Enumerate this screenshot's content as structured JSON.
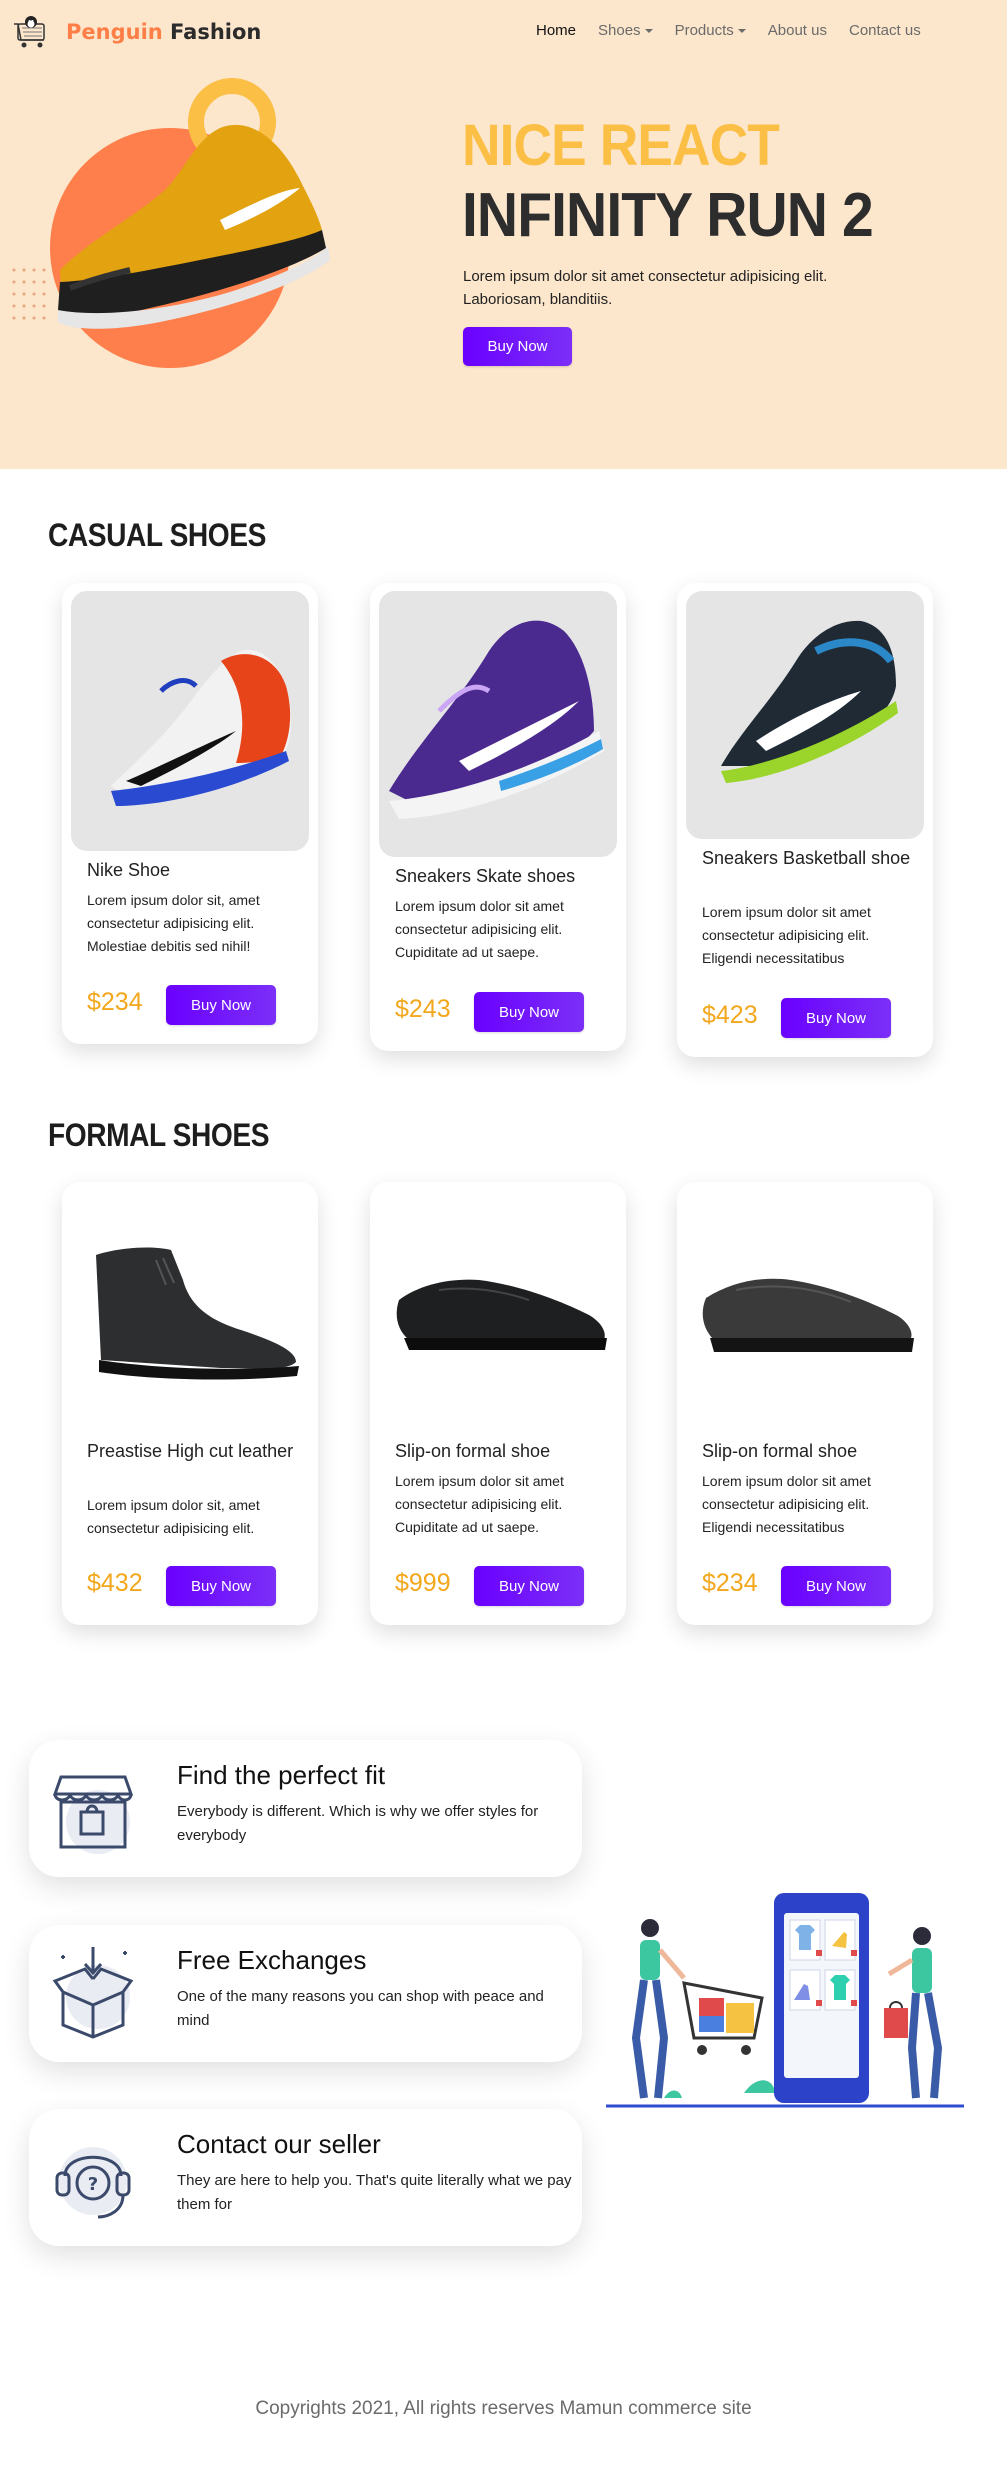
{
  "brand": {
    "accent": "Penguin",
    "rest": "Fashion"
  },
  "nav": {
    "links": [
      {
        "label": "Home",
        "dropdown": false,
        "active": true
      },
      {
        "label": "Shoes",
        "dropdown": true,
        "active": false
      },
      {
        "label": "Products",
        "dropdown": true,
        "active": false
      },
      {
        "label": "About us",
        "dropdown": false,
        "active": false
      },
      {
        "label": "Contact us",
        "dropdown": false,
        "active": false
      }
    ]
  },
  "hero": {
    "title_line1": "NICE REACT",
    "title_line2": "INFINITY RUN 2",
    "text": "Lorem ipsum dolor sit amet consectetur adipisicing elit. Laboriosam, blanditiis.",
    "button": "Buy Now"
  },
  "casual": {
    "title": "CASUAL SHOES",
    "cards": [
      {
        "name": "Nike Shoe",
        "desc": "Lorem ipsum dolor sit, amet consectetur adipisicing elit. Molestiae debitis sed nihil!",
        "price": "$234",
        "button": "Buy Now"
      },
      {
        "name": "Sneakers Skate shoes",
        "desc": "Lorem ipsum dolor sit amet consectetur adipisicing elit. Cupiditate ad ut saepe.",
        "price": "$243",
        "button": "Buy Now"
      },
      {
        "name": "Sneakers Basketball shoe",
        "desc": "Lorem ipsum dolor sit amet consectetur adipisicing elit. Eligendi necessitatibus",
        "price": "$423",
        "button": "Buy Now"
      }
    ]
  },
  "formal": {
    "title": "FORMAL SHOES",
    "cards": [
      {
        "name": "Preastise High cut leather",
        "desc": "Lorem ipsum dolor sit, amet consectetur adipisicing elit.",
        "price": "$432",
        "button": "Buy Now"
      },
      {
        "name": "Slip-on formal shoe",
        "desc": "Lorem ipsum dolor sit amet consectetur adipisicing elit. Cupiditate ad ut saepe.",
        "price": "$999",
        "button": "Buy Now"
      },
      {
        "name": "Slip-on formal shoe",
        "desc": "Lorem ipsum dolor sit amet consectetur adipisicing elit. Eligendi necessitatibus",
        "price": "$234",
        "button": "Buy Now"
      }
    ]
  },
  "features": [
    {
      "title": "Find the perfect fit",
      "text": "Everybody is different. Which is why we offer styles for everybody",
      "icon": "shop-icon"
    },
    {
      "title": "Free Exchanges",
      "text": "One of the many reasons you can shop with peace and mind",
      "icon": "box-icon"
    },
    {
      "title": "Contact our seller",
      "text": "They are here to help you. That's quite literally what we pay them for",
      "icon": "support-icon"
    }
  ],
  "footer": {
    "text": "Copyrights 2021, All rights reserves Mamun commerce site"
  },
  "colors": {
    "hero_bg": "#fce6cc",
    "accent_orange": "#fd7e47",
    "title_yellow": "#fbbf45",
    "price": "#f3a71c",
    "button": "#6a00ff"
  }
}
